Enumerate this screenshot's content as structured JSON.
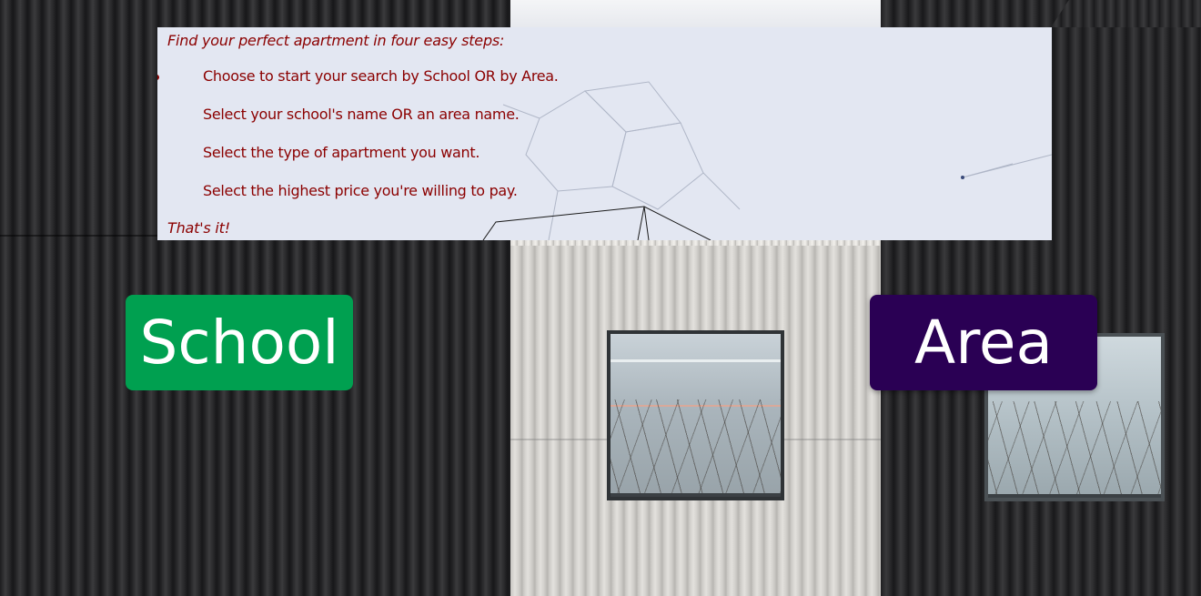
{
  "info": {
    "intro": "Find your perfect apartment in four easy steps:",
    "steps": [
      "Choose to start your search by School OR by Area.",
      "Select your school's name OR an area name.",
      "Select the type of apartment you want.",
      "Select the highest price you're willing to pay."
    ],
    "outro": "That's it!"
  },
  "buttons": {
    "school_label": "School",
    "area_label": "Area"
  },
  "colors": {
    "text_accent": "#8b0000",
    "school_button": "#00a050",
    "area_button": "#2a0054",
    "panel_background": "#e3e7f2"
  },
  "icons": {
    "list_bullet": "bullet-dot-icon"
  }
}
